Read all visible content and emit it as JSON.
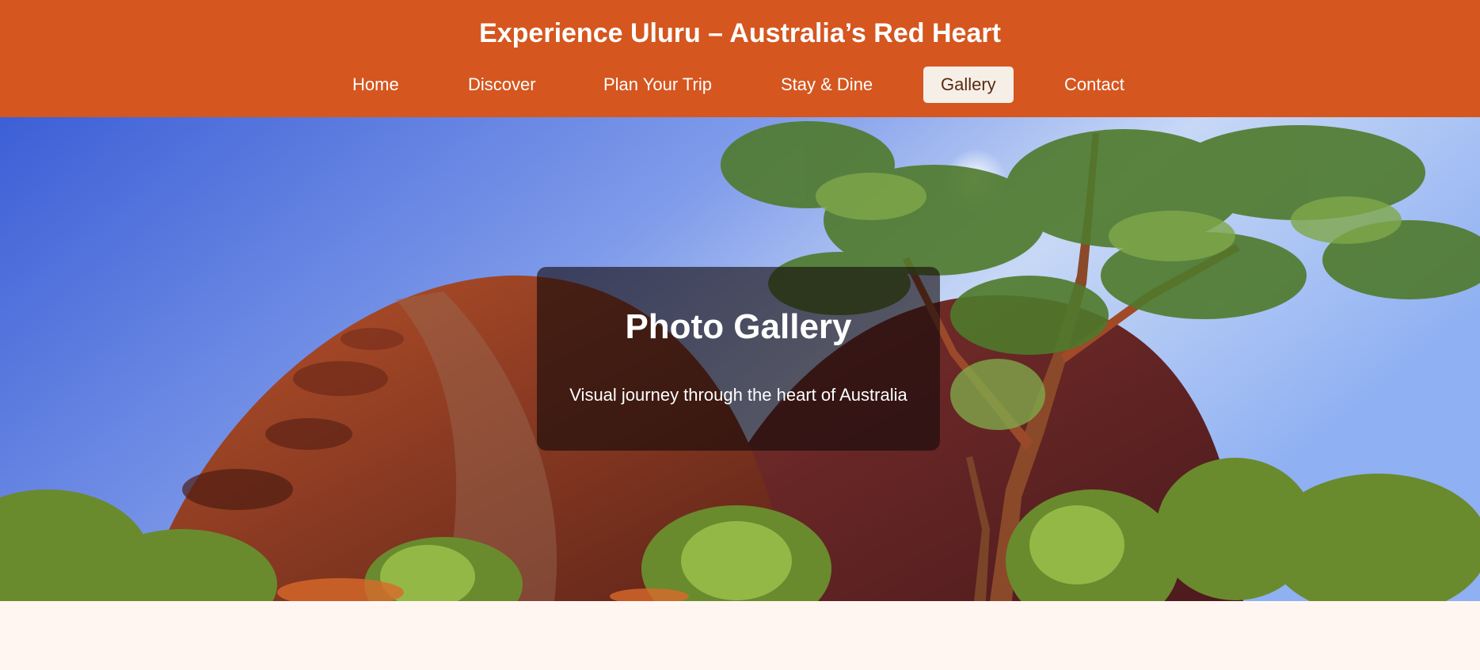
{
  "header": {
    "title": "Experience Uluru – Australia’s Red Heart",
    "background_color": "#d5561f"
  },
  "nav": {
    "items": [
      {
        "label": "Home"
      },
      {
        "label": "Discover"
      },
      {
        "label": "Plan Your Trip"
      },
      {
        "label": "Stay & Dine"
      },
      {
        "label": "Gallery",
        "active": true
      },
      {
        "label": "Contact"
      }
    ]
  },
  "hero": {
    "image": "uluru-with-eucalyptus-tree",
    "title": "Photo Gallery",
    "subtitle": "Visual journey through the heart of Australia"
  },
  "page": {
    "background_color": "#fff6f1"
  }
}
